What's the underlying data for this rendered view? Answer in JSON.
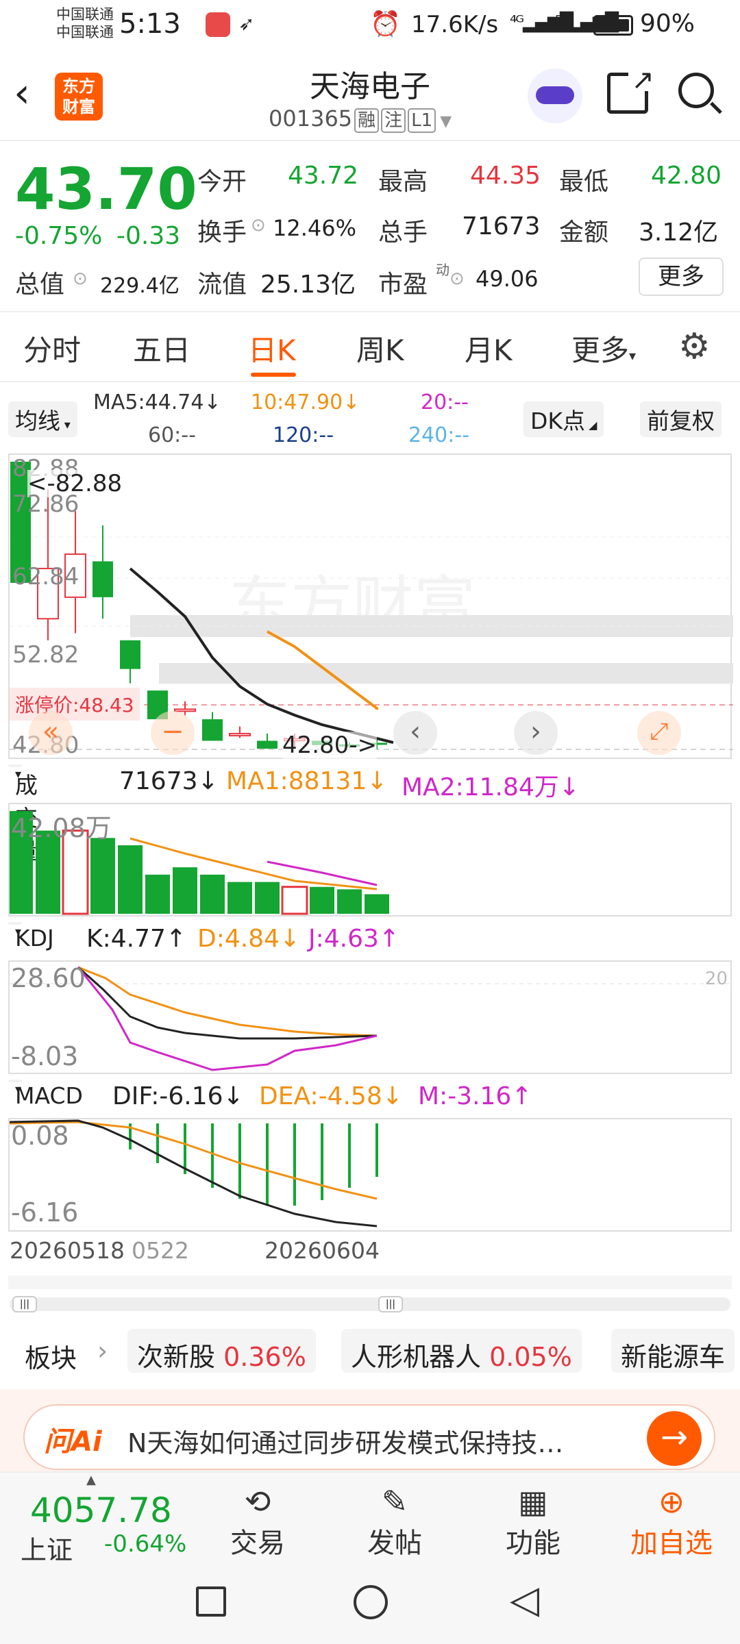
{
  "status": {
    "carrier1": "中国联通",
    "carrier2": "中国联通",
    "time": "5:13",
    "speed": "17.6K/s",
    "battery": "90%"
  },
  "header": {
    "app_logo": "东方\n财富",
    "stock_name": "天海电子",
    "stock_code": "001365",
    "tags": [
      "融",
      "注",
      "L1"
    ]
  },
  "quote": {
    "price": "43.70",
    "pct": "-0.75%",
    "change": "-0.33",
    "open_label": "今开",
    "open": "43.72",
    "high_label": "最高",
    "high": "44.35",
    "low_label": "最低",
    "low": "42.80",
    "turnover_label": "换手",
    "turnover": "12.46%",
    "volume_label": "总手",
    "volume": "71673",
    "amount_label": "金额",
    "amount": "3.12亿",
    "mktcap_label": "总值",
    "mktcap": "229.4亿",
    "float_label": "流值",
    "float": "25.13亿",
    "pe_label": "市盈",
    "pe_sup": "动",
    "pe": "49.06",
    "more": "更多"
  },
  "tabs": [
    "分时",
    "五日",
    "日K",
    "周K",
    "月K",
    "更多"
  ],
  "ma": {
    "select": "均线",
    "ma5": "MA5:44.74↓",
    "ma10": "10:47.90↓",
    "ma20": "20:--",
    "ma60": "60:--",
    "ma120": "120:--",
    "ma240": "240:--",
    "dk": "DK点",
    "fq": "前复权"
  },
  "kline": {
    "y_labels": [
      "82.88",
      "72.86",
      "62.84",
      "52.82",
      "42.80"
    ],
    "max_note": "<-82.88",
    "min_note": "42.80->",
    "limit_label": "涨停价:48.43"
  },
  "volume": {
    "select": "成交量",
    "value": "71673↓",
    "ma1": "MA1:88131↓",
    "ma2": "MA2:11.84万↓",
    "y_max": "42.08万"
  },
  "kdj": {
    "select": "KDJ",
    "k": "K:4.77↑",
    "d": "D:4.84↓",
    "j": "J:4.63↑",
    "y_top": "28.60",
    "y_bot": "-8.03",
    "ref": "20"
  },
  "macd": {
    "select": "MACD",
    "dif": "DIF:-6.16↓",
    "dea": "DEA:-4.58↓",
    "m": "M:-3.16↑",
    "y_top": "0.08",
    "y_bot": "-6.16"
  },
  "dates": {
    "d1": "20260518",
    "d2": "0522",
    "d3": "20260604"
  },
  "sectors": {
    "label": "板块",
    "items": [
      {
        "name": "次新股",
        "pct": "0.36%"
      },
      {
        "name": "人形机器人",
        "pct": "0.05%"
      },
      {
        "name": "新能源车",
        "pct": ""
      }
    ]
  },
  "ai": {
    "logo": "问Ai",
    "text": "N天海如何通过同步研发模式保持技…"
  },
  "bottom": {
    "index_value": "4057.78",
    "index_name": "上证",
    "index_pct": "-0.64%",
    "trade": "交易",
    "post": "发帖",
    "func": "功能",
    "add": "加自选"
  },
  "colors": {
    "up": "#e5363f",
    "down": "#14a532",
    "accent": "#ff5a00"
  },
  "candles": [
    {
      "o": 82.88,
      "c": 66,
      "h": 82.88,
      "l": 66,
      "up": false
    },
    {
      "o": 61,
      "c": 68,
      "h": 79,
      "l": 58,
      "up": true
    },
    {
      "o": 64,
      "c": 70,
      "h": 76,
      "l": 59,
      "up": true
    },
    {
      "o": 69,
      "c": 64,
      "h": 74,
      "l": 61,
      "up": false
    },
    {
      "o": 58,
      "c": 54,
      "h": 58,
      "l": 52,
      "up": false
    },
    {
      "o": 51,
      "c": 47,
      "h": 51,
      "l": 47,
      "up": false
    },
    {
      "o": 48.4,
      "c": 48.4,
      "h": 49.5,
      "l": 47.5,
      "up": true
    },
    {
      "o": 47,
      "c": 44,
      "h": 48,
      "l": 44,
      "up": false
    },
    {
      "o": 45,
      "c": 45,
      "h": 46,
      "l": 44.4,
      "up": true
    },
    {
      "o": 44,
      "c": 42.9,
      "h": 45,
      "l": 42.9,
      "up": false
    },
    {
      "o": 44.3,
      "c": 44.3,
      "h": 45,
      "l": 43,
      "up": true
    },
    {
      "o": 44,
      "c": 43.4,
      "h": 44.5,
      "l": 43,
      "up": false
    },
    {
      "o": 43.5,
      "c": 43.2,
      "h": 43.8,
      "l": 43,
      "up": false
    },
    {
      "o": 43.72,
      "c": 43.7,
      "h": 44.35,
      "l": 42.8,
      "up": false
    }
  ],
  "vols": [
    {
      "v": 42,
      "up": false
    },
    {
      "v": 34,
      "up": false
    },
    {
      "v": 34,
      "up": true
    },
    {
      "v": 31,
      "up": false
    },
    {
      "v": 28,
      "up": false
    },
    {
      "v": 16,
      "up": false
    },
    {
      "v": 19,
      "up": false
    },
    {
      "v": 16,
      "up": false
    },
    {
      "v": 13,
      "up": false
    },
    {
      "v": 13,
      "up": false
    },
    {
      "v": 11,
      "up": true
    },
    {
      "v": 11,
      "up": false
    },
    {
      "v": 10,
      "up": false
    },
    {
      "v": 8,
      "up": false
    }
  ]
}
